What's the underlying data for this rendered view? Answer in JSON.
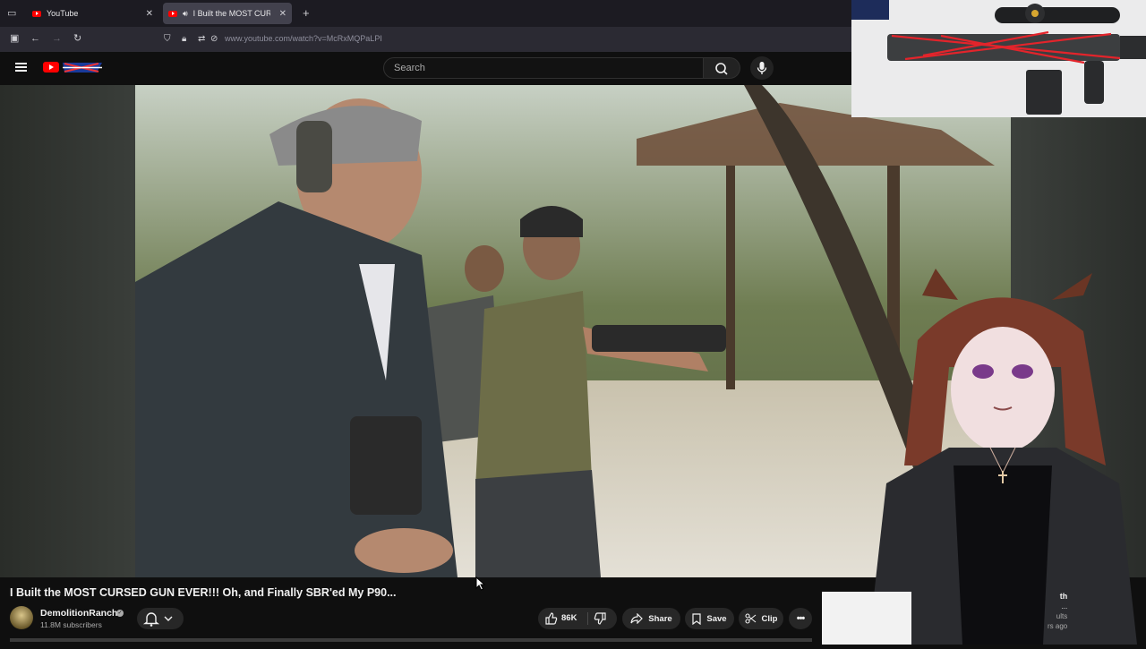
{
  "browser": {
    "tabs": [
      {
        "label": "YouTube",
        "active": false
      },
      {
        "label": "I Built the MOST CURSED G",
        "active": true
      }
    ],
    "new_tab_symbol": "+",
    "url": "www.youtube.com/watch?v=McRxMQPaLPI"
  },
  "youtube": {
    "search_placeholder": "Search",
    "video": {
      "title": "I Built the MOST CURSED GUN EVER!!! Oh, and Finally SBR'ed My P90...",
      "channel": "DemolitionRanch",
      "subscribers": "11.8M subscribers",
      "likes": "86K",
      "actions": {
        "share": "Share",
        "save": "Save",
        "clip": "Clip"
      }
    },
    "sidebar_snippet": {
      "line1": "th",
      "line2": "...",
      "line3": "ults",
      "line4": "rs ago"
    }
  },
  "colors": {
    "youtube_red": "#ff0000",
    "background": "#0f0f0f",
    "pill": "#272727",
    "browser_tabbar": "#1c1b22",
    "browser_active_tab": "#42414d"
  },
  "icons": [
    "menu-icon",
    "youtube-logo",
    "search-icon",
    "mic-icon",
    "bell-icon",
    "chevron-down-icon",
    "like-icon",
    "dislike-icon",
    "share-icon",
    "save-icon",
    "clip-icon",
    "more-icon",
    "back-icon",
    "forward-icon",
    "reload-icon",
    "lock-icon",
    "shield-icon"
  ]
}
